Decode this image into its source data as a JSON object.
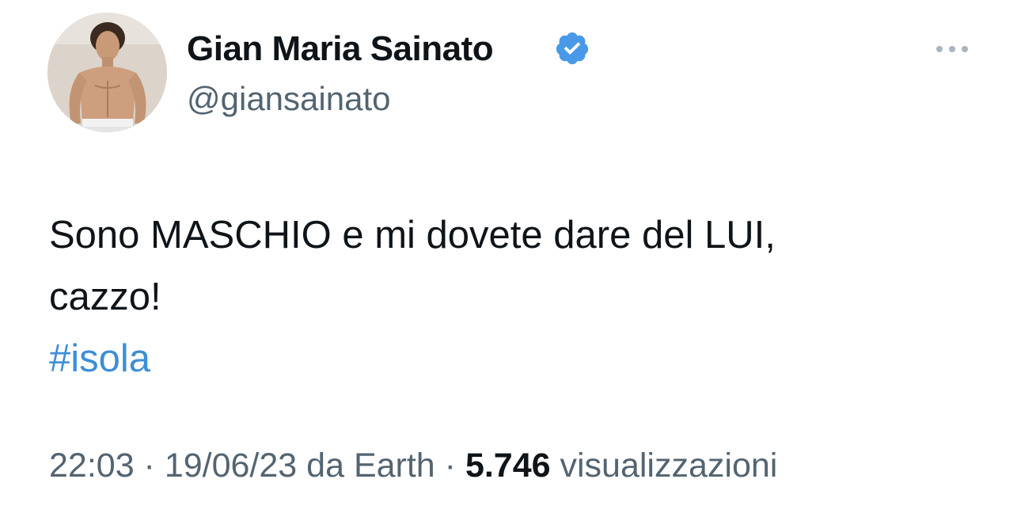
{
  "author": {
    "display_name": "Gian Maria Sainato",
    "handle": "@giansainato",
    "verified_icon": "verified-badge-icon",
    "avatar_icon": "profile-photo"
  },
  "menu": {
    "icon": "more-options-icon"
  },
  "tweet": {
    "text_line_1": "Sono MASCHIO e mi dovete dare del LUI,",
    "text_line_2": "cazzo!",
    "hashtag": "#isola"
  },
  "meta": {
    "time": "22:03",
    "separator_1": " · ",
    "date": "19/06/23",
    "source": " da Earth",
    "separator_2": " · ",
    "views_count": "5.746",
    "views_label": " visualizzazioni"
  },
  "colors": {
    "link": "#3d8ed6",
    "secondary_text": "#536471",
    "primary_text": "#0f1419",
    "verified": "#4a99e9"
  }
}
